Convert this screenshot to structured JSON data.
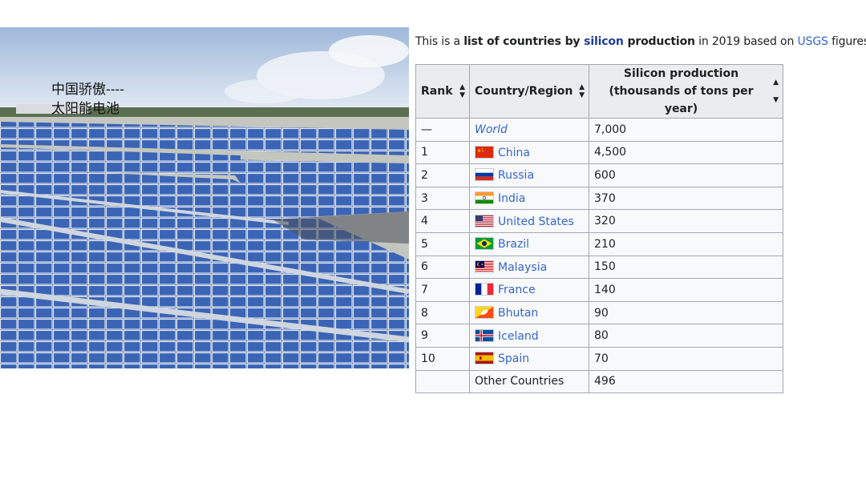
{
  "caption": {
    "line1": "中国骄傲----",
    "line2": "太阳能电池"
  },
  "intro": {
    "part1": "This is a ",
    "bold1": "list of countries by ",
    "link_bold": "silicon",
    "bold2": " production",
    "part2": " in 2019 based on ",
    "link": "USGS",
    "part3": " figures."
  },
  "table": {
    "headers": {
      "rank": "Rank",
      "country": "Country/Region",
      "production_line1": "Silicon production",
      "production_line2": "(thousands of tons per year)"
    },
    "sort_icon": "sort-icon",
    "rows": [
      {
        "rank": "—",
        "country": "World",
        "value": "7,000",
        "flag": "",
        "link": true
      },
      {
        "rank": "1",
        "country": "China",
        "value": "4,500",
        "flag": "china-flag-icon",
        "link": true
      },
      {
        "rank": "2",
        "country": "Russia",
        "value": "600",
        "flag": "russia-flag-icon",
        "link": true
      },
      {
        "rank": "3",
        "country": "India",
        "value": "370",
        "flag": "india-flag-icon",
        "link": true
      },
      {
        "rank": "4",
        "country": "United States",
        "value": "320",
        "flag": "united-states-flag-icon",
        "link": true
      },
      {
        "rank": "5",
        "country": "Brazil",
        "value": "210",
        "flag": "brazil-flag-icon",
        "link": true
      },
      {
        "rank": "6",
        "country": "Malaysia",
        "value": "150",
        "flag": "malaysia-flag-icon",
        "link": true
      },
      {
        "rank": "7",
        "country": "France",
        "value": "140",
        "flag": "france-flag-icon",
        "link": true
      },
      {
        "rank": "8",
        "country": "Bhutan",
        "value": "90",
        "flag": "bhutan-flag-icon",
        "link": true
      },
      {
        "rank": "9",
        "country": "Iceland",
        "value": "80",
        "flag": "iceland-flag-icon",
        "link": true
      },
      {
        "rank": "10",
        "country": "Spain",
        "value": "70",
        "flag": "spain-flag-icon",
        "link": true
      },
      {
        "rank": "",
        "country": "Other Countries",
        "value": "496",
        "flag": "",
        "link": false
      }
    ]
  },
  "colors": {
    "link": "#3366cc",
    "header_bg": "#eaecf0",
    "cell_bg": "#f8f9fa",
    "border": "#a2a9b1"
  }
}
